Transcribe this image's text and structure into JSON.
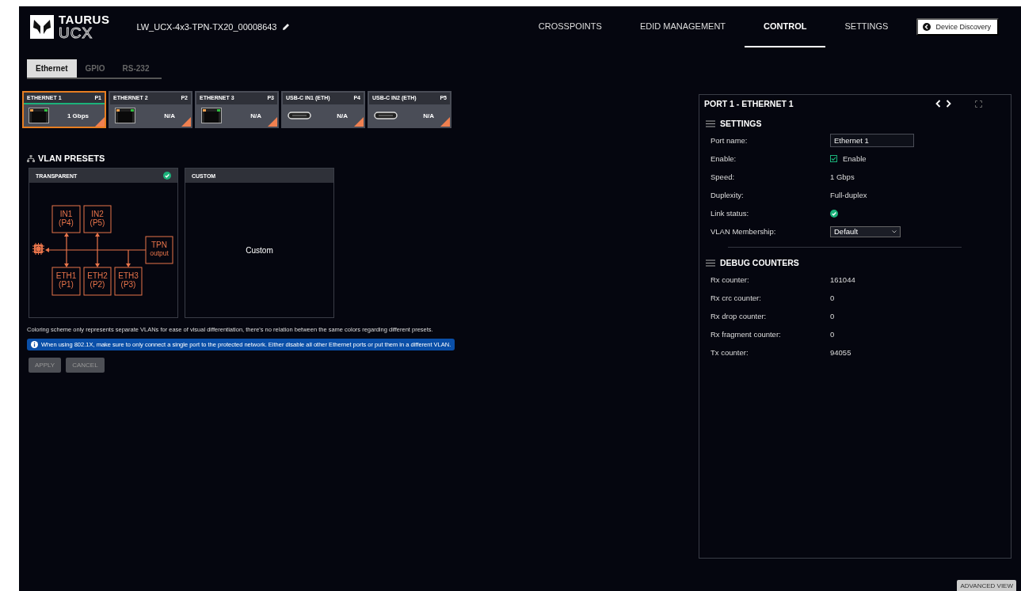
{
  "logo": {
    "line1": "TAURUS",
    "line2": "UCX"
  },
  "device_name": "LW_UCX-4x3-TPN-TX20_00008643",
  "nav": [
    {
      "label": "CROSSPOINTS",
      "selected": false
    },
    {
      "label": "EDID MANAGEMENT",
      "selected": false
    },
    {
      "label": "CONTROL",
      "selected": true
    },
    {
      "label": "SETTINGS",
      "selected": false
    }
  ],
  "device_discovery_button": "Device Discovery",
  "sub_tabs": [
    {
      "label": "Ethernet",
      "selected": true
    },
    {
      "label": "GPIO",
      "selected": false
    },
    {
      "label": "RS-232",
      "selected": false
    }
  ],
  "ports": [
    {
      "name": "ETHERNET 1",
      "port": "P1",
      "kind": "rj45",
      "value": "1 Gbps",
      "selected": true,
      "link": true
    },
    {
      "name": "ETHERNET 2",
      "port": "P2",
      "kind": "rj45",
      "value": "N/A",
      "selected": false,
      "link": false
    },
    {
      "name": "ETHERNET 3",
      "port": "P3",
      "kind": "rj45",
      "value": "N/A",
      "selected": false,
      "link": false
    },
    {
      "name": "USB-C IN1 (ETH)",
      "port": "P4",
      "kind": "usbc",
      "value": "N/A",
      "selected": false,
      "link": false
    },
    {
      "name": "USB-C IN2 (ETH)",
      "port": "P5",
      "kind": "usbc",
      "value": "N/A",
      "selected": false,
      "link": false
    }
  ],
  "vlan_presets": {
    "title": "VLAN PRESETS",
    "presets": [
      {
        "title": "TRANSPARENT",
        "kind": "diagram",
        "active": true,
        "nodes": [
          {
            "lines": [
              "IN1",
              "(P4)"
            ]
          },
          {
            "lines": [
              "IN2",
              "(P5)"
            ]
          },
          {
            "lines": [
              "TPN",
              "output"
            ]
          },
          {
            "lines": [
              "ETH1",
              "(P1)"
            ]
          },
          {
            "lines": [
              "ETH2",
              "(P2)"
            ]
          },
          {
            "lines": [
              "ETH3",
              "(P3)"
            ]
          }
        ]
      },
      {
        "title": "CUSTOM",
        "kind": "text",
        "active": false,
        "text": "Custom"
      }
    ]
  },
  "note": "Coloring scheme only represents separate VLANs for ease of visual differentiation, there's no relation between the same colors regarding different presets.",
  "info": "When using 802.1X, make sure to only connect a single port to the protected network. Either disable all other Ethernet ports or put them in a different VLAN.",
  "buttons": [
    {
      "label": "APPLY",
      "disabled": true
    },
    {
      "label": "CANCEL",
      "disabled": true
    }
  ],
  "port_panel": {
    "title": "PORT 1 - ETHERNET 1",
    "sections": [
      {
        "title": "SETTINGS",
        "rows": [
          {
            "label": "Port name:",
            "kind": "input",
            "value": "Ethernet 1"
          },
          {
            "label": "Enable:",
            "kind": "checkbox",
            "value": "Enable",
            "checked": true
          },
          {
            "label": "Speed:",
            "kind": "text",
            "value": "1 Gbps"
          },
          {
            "label": "Duplexity:",
            "kind": "text",
            "value": "Full-duplex"
          },
          {
            "label": "Link status:",
            "kind": "status",
            "ok": true
          },
          {
            "label": "VLAN Membership:",
            "kind": "select",
            "value": "Default"
          }
        ]
      },
      {
        "title": "DEBUG COUNTERS",
        "rows": [
          {
            "label": "Rx counter:",
            "kind": "text",
            "value": "161044"
          },
          {
            "label": "Rx crc counter:",
            "kind": "text",
            "value": "0"
          },
          {
            "label": "Rx drop counter:",
            "kind": "text",
            "value": "0"
          },
          {
            "label": "Rx fragment counter:",
            "kind": "text",
            "value": "0"
          },
          {
            "label": "Tx counter:",
            "kind": "text",
            "value": "94055"
          }
        ]
      }
    ]
  },
  "advanced_view_button": "ADVANCED VIEW"
}
